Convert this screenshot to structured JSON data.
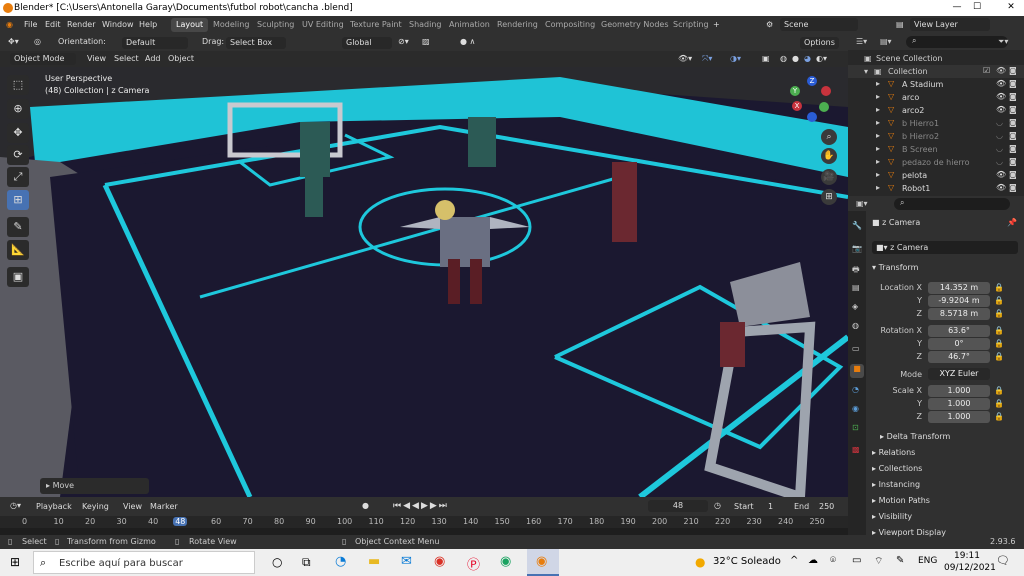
{
  "titlebar": {
    "title": "Blender* [C:\\Users\\Antonella Garay\\Documents\\futbol robot\\cancha .blend]",
    "minimize": "—",
    "maximize": "☐",
    "close": "✕"
  },
  "menubar": {
    "file": "File",
    "edit": "Edit",
    "render": "Render",
    "window": "Window",
    "help": "Help",
    "workspaces": [
      "Layout",
      "Modeling",
      "Sculpting",
      "UV Editing",
      "Texture Paint",
      "Shading",
      "Animation",
      "Rendering",
      "Compositing",
      "Geometry Nodes",
      "Scripting"
    ],
    "add_tab": "+",
    "scene": "Scene",
    "view_layer": "View Layer"
  },
  "header": {
    "orientation_label": "Orientation:",
    "orientation_value": "Default",
    "drag_label": "Drag:",
    "drag_value": "Select Box",
    "transform_orientation": "Global",
    "options": "Options"
  },
  "viewport_header": {
    "mode": "Object Mode",
    "view": "View",
    "select": "Select",
    "add": "Add",
    "object": "Object"
  },
  "viewport": {
    "perspective": "User Perspective",
    "collection_info": "(48) Collection | z Camera",
    "move_panel": "Move",
    "axis_x": "X",
    "axis_y": "Y",
    "axis_z": "Z"
  },
  "timeline": {
    "playback": "Playback",
    "keying": "Keying",
    "view": "View",
    "marker": "Marker",
    "current_frame": "48",
    "start_label": "Start",
    "start_value": "1",
    "end_label": "End",
    "end_value": "250",
    "ticks": [
      "0",
      "10",
      "20",
      "30",
      "40",
      "48",
      "60",
      "70",
      "80",
      "90",
      "100",
      "110",
      "120",
      "130",
      "140",
      "150",
      "160",
      "170",
      "180",
      "190",
      "200",
      "210",
      "220",
      "230",
      "240",
      "250"
    ]
  },
  "statusbar": {
    "select": "Select",
    "transform": "Transform from Gizmo",
    "rotate": "Rotate View",
    "context_menu": "Object Context Menu",
    "version": "2.93.6"
  },
  "taskbar": {
    "search_placeholder": "Escribe aquí para buscar",
    "weather": "32°C Soleado",
    "language": "ENG",
    "time": "19:11",
    "date": "09/12/2021"
  },
  "outliner": {
    "scene_collection": "Scene Collection",
    "collection": "Collection",
    "items": [
      {
        "name": "A Stadium",
        "dim": false
      },
      {
        "name": "arco",
        "dim": false
      },
      {
        "name": "arco2",
        "dim": false
      },
      {
        "name": "b Hierro1",
        "dim": true
      },
      {
        "name": "b Hierro2",
        "dim": true
      },
      {
        "name": "B Screen",
        "dim": true
      },
      {
        "name": "pedazo de hierro",
        "dim": true
      },
      {
        "name": "pelota",
        "dim": false
      },
      {
        "name": "Robot1",
        "dim": false
      }
    ]
  },
  "properties": {
    "object_name": "z Camera",
    "data_name": "z Camera",
    "transform": "Transform",
    "location_label": "Location X",
    "location": [
      "14.352 m",
      "-9.9204 m",
      "8.5718 m"
    ],
    "rotation_label": "Rotation X",
    "rotation": [
      "63.6°",
      "0°",
      "46.7°"
    ],
    "mode_label": "Mode",
    "mode_value": "XYZ Euler",
    "scale_label": "Scale X",
    "scale": [
      "1.000",
      "1.000",
      "1.000"
    ],
    "y": "Y",
    "z": "Z",
    "delta_transform": "Delta Transform",
    "sections": [
      "Relations",
      "Collections",
      "Instancing",
      "Motion Paths",
      "Visibility",
      "Viewport Display"
    ]
  },
  "colors": {
    "accent": "#4772b3",
    "field_line": "#1ec8dc",
    "pitch": "#1b1830",
    "orange": "#e87d0d"
  }
}
